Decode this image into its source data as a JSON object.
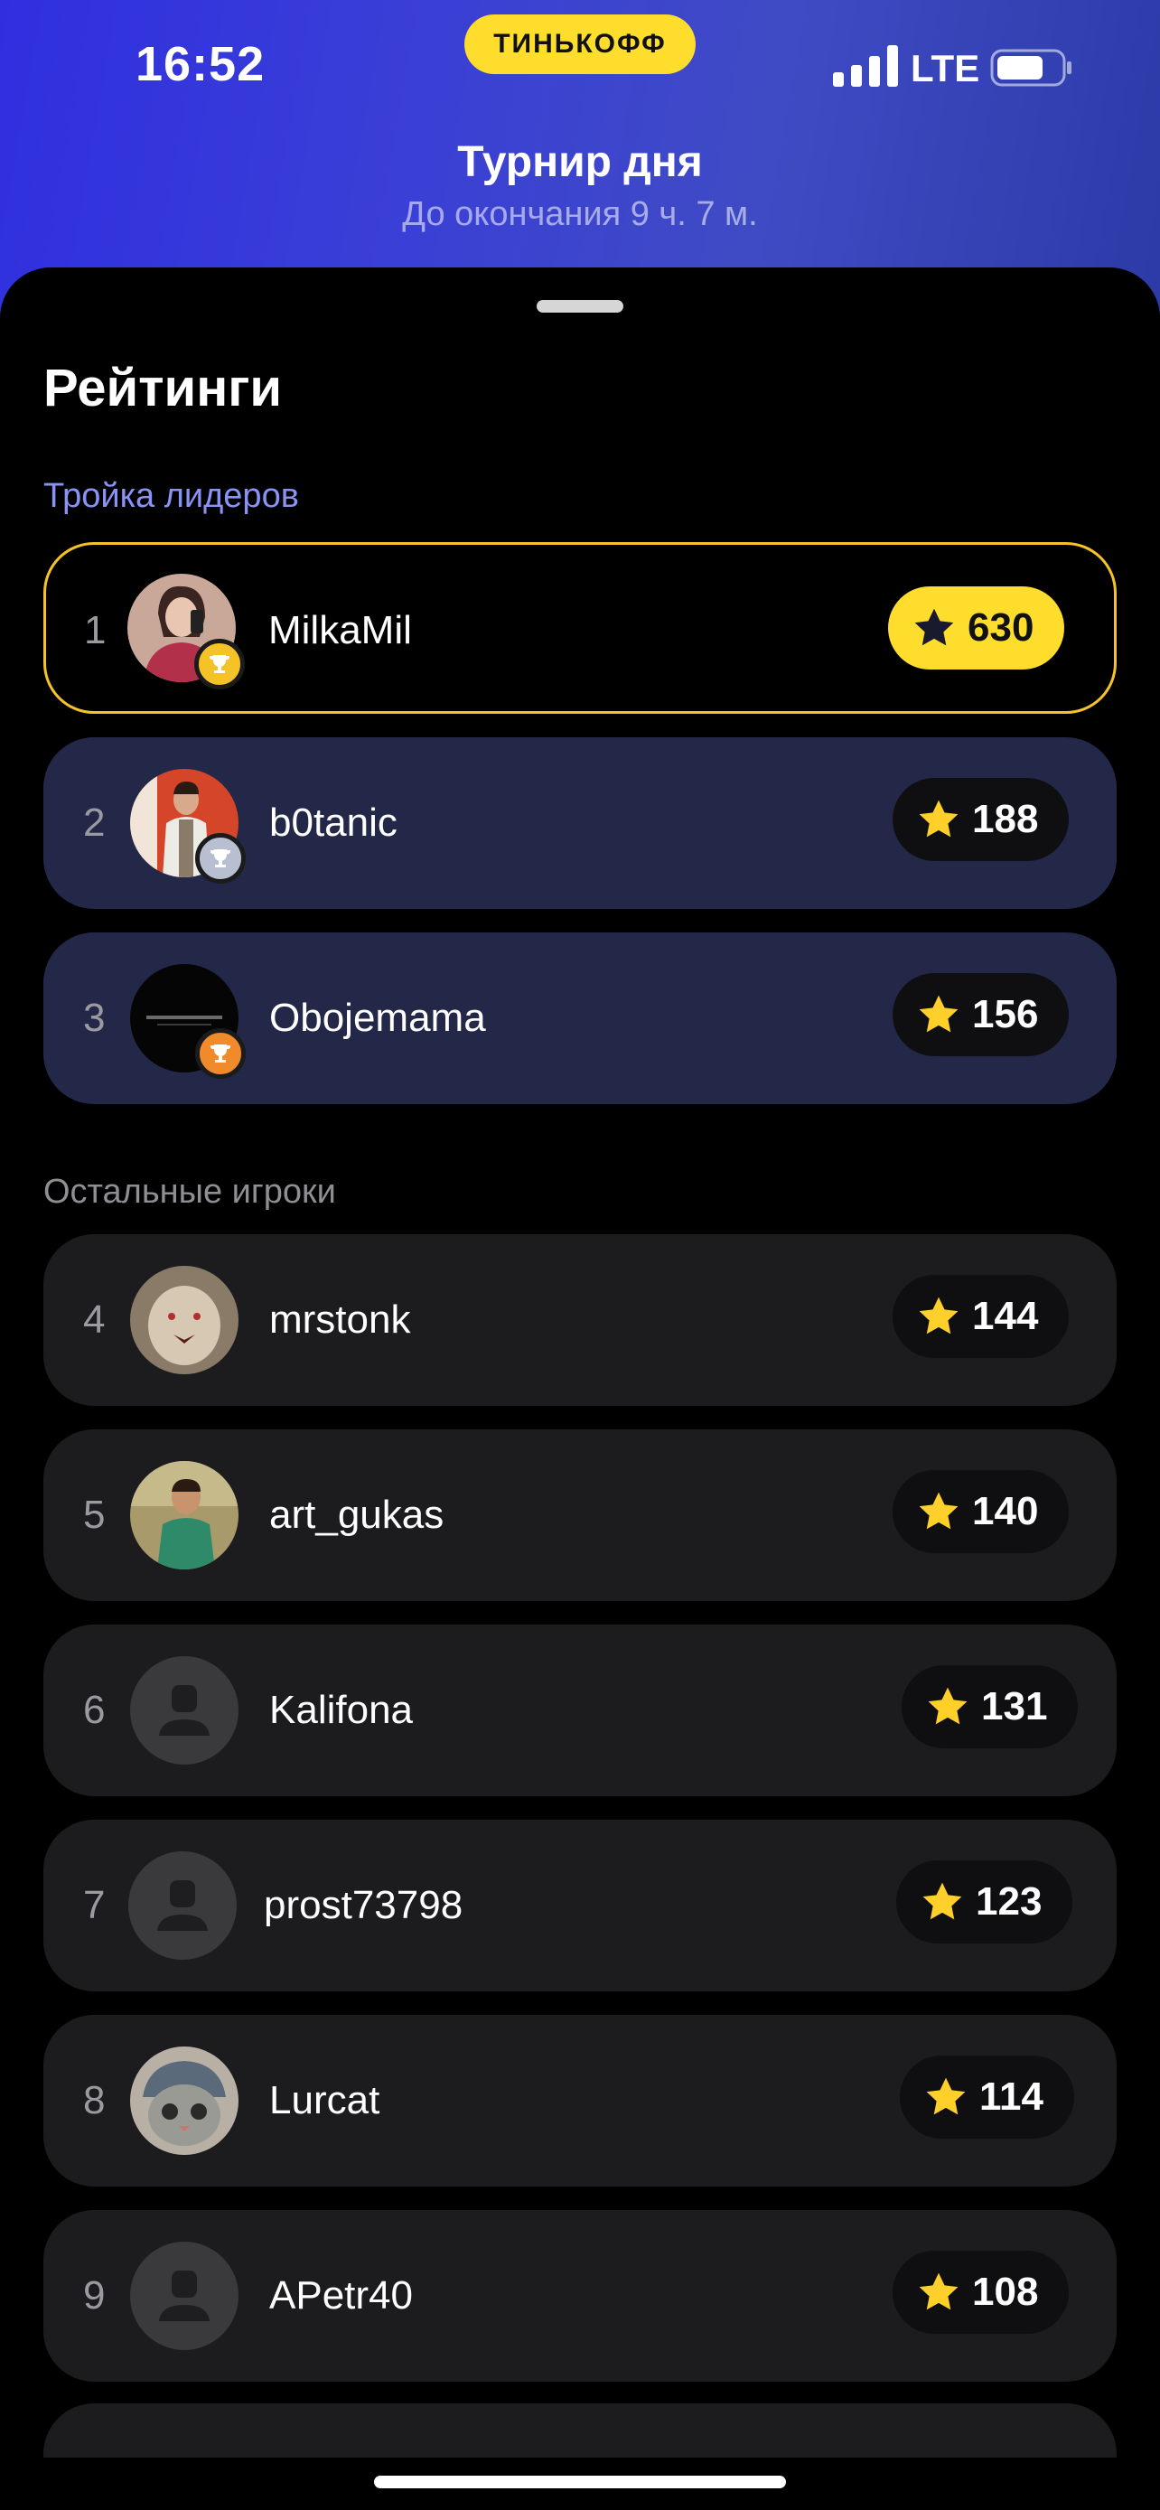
{
  "status_bar": {
    "time": "16:52",
    "brand": "ТИНЬКОФФ",
    "network": "LTE"
  },
  "header": {
    "title": "Турнир дня",
    "subtitle": "До окончания 9 ч. 7 м."
  },
  "page_title": "Рейтинги",
  "sections": {
    "leaders_label": "Тройка лидеров",
    "others_label": "Остальные игроки"
  },
  "colors": {
    "accent_gold": "#ffdd2d",
    "leader_row_bg": "#232848",
    "other_row_bg": "#1c1c1e",
    "section_label": "#8a92f5"
  },
  "leaders": [
    {
      "rank": "1",
      "name": "MilkaMil",
      "score": "630",
      "trophy": "gold-trophy-icon",
      "avatar": "photo"
    },
    {
      "rank": "2",
      "name": "b0tanic",
      "score": "188",
      "trophy": "silver-trophy-icon",
      "avatar": "photo"
    },
    {
      "rank": "3",
      "name": "Obojemama",
      "score": "156",
      "trophy": "bronze-trophy-icon",
      "avatar": "logo"
    }
  ],
  "players": [
    {
      "rank": "4",
      "name": "mrstonk",
      "score": "144",
      "avatar": "photo"
    },
    {
      "rank": "5",
      "name": "art_gukas",
      "score": "140",
      "avatar": "photo"
    },
    {
      "rank": "6",
      "name": "Kalifona",
      "score": "131",
      "avatar": "placeholder"
    },
    {
      "rank": "7",
      "name": "prost73798",
      "score": "123",
      "avatar": "placeholder"
    },
    {
      "rank": "8",
      "name": "Lurcat",
      "score": "114",
      "avatar": "photo"
    },
    {
      "rank": "9",
      "name": "APetr40",
      "score": "108",
      "avatar": "placeholder"
    }
  ]
}
